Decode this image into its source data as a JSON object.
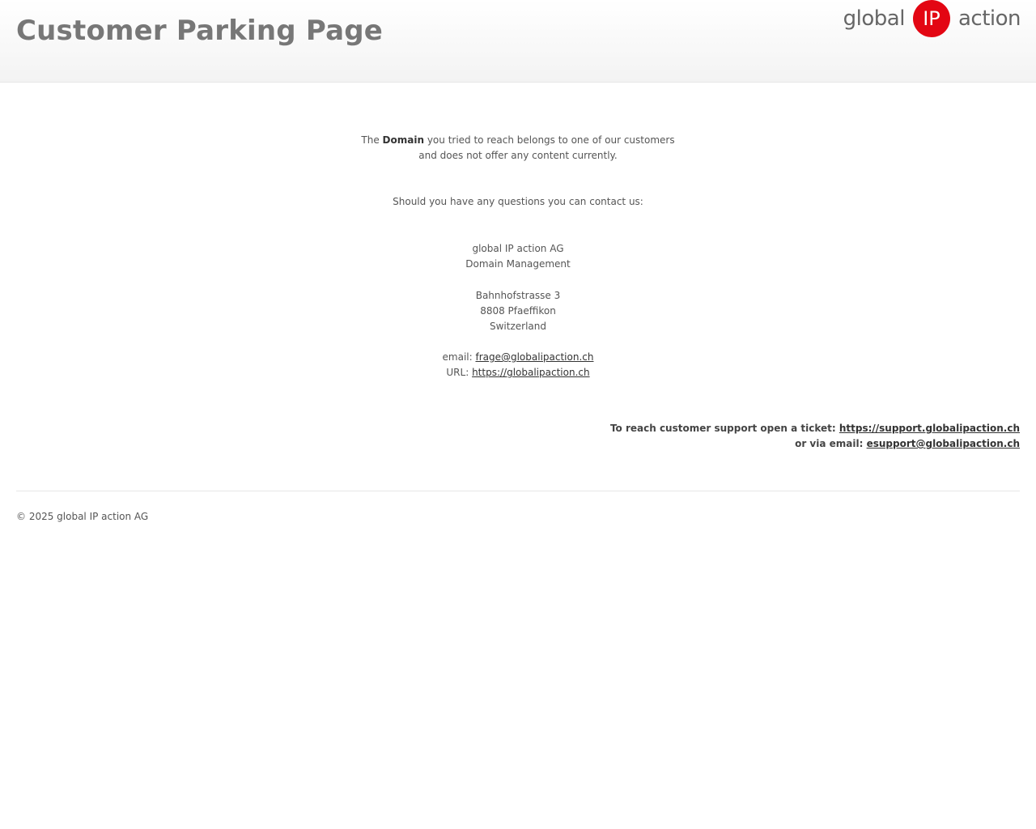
{
  "header": {
    "title": "Customer Parking Page",
    "logo": {
      "left_word": "global",
      "circle_text": "IP",
      "right_word": "action",
      "circle_color": "#e30613"
    }
  },
  "main": {
    "intro_prefix": "The ",
    "intro_bold": "Domain",
    "intro_suffix": " you tried to reach belongs to one of our customers",
    "intro_line2": "and does not offer any content currently.",
    "contact_intro": "Should you have any questions you can contact us:",
    "company_name": "global IP action AG",
    "department": "Domain Management",
    "street": "Bahnhofstrasse 3",
    "city": "8808 Pfaeffikon",
    "country": "Switzerland",
    "email_label": "email: ",
    "email": "frage@globalipaction.ch",
    "url_label": "URL: ",
    "url": "https://globalipaction.ch"
  },
  "support": {
    "ticket_label": "To reach customer support open a ticket: ",
    "ticket_url": "https://support.globalipaction.ch",
    "email_label": "or via email: ",
    "email": "esupport@globalipaction.ch"
  },
  "footer": {
    "copyright": "© 2025 global IP action AG"
  }
}
